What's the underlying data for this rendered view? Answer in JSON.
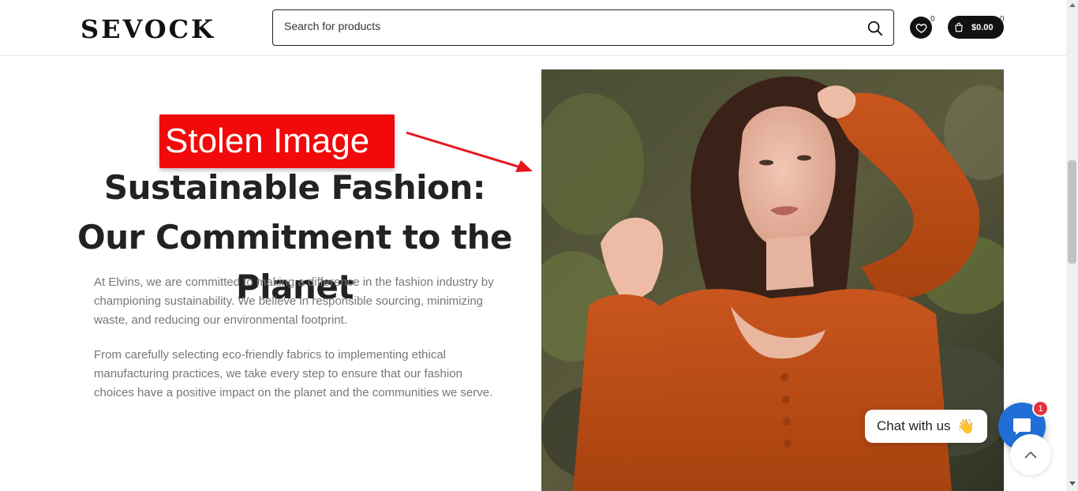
{
  "header": {
    "logo": "SEVOCK",
    "search_placeholder": "Search for products",
    "wishlist_count": "0",
    "cart_total": "$0.00",
    "cart_count": "0"
  },
  "annotation": {
    "label": "Stolen Image",
    "color": "#f20909"
  },
  "main": {
    "title": "Sustainable Fashion: Our Commitment to the Planet",
    "paragraph_1": "At Elvins, we are committed to making a difference in the fashion industry by championing sustainability. We believe in responsible sourcing, minimizing waste, and reducing our environmental footprint.",
    "paragraph_2": "From carefully selecting eco-friendly fabrics to implementing ethical manufacturing practices, we take every step to ensure that our fashion choices have a positive impact on the planet and the communities we serve."
  },
  "chat": {
    "label": "Chat with us",
    "wave": "👋",
    "badge": "1",
    "accent": "#1f6fd6"
  }
}
